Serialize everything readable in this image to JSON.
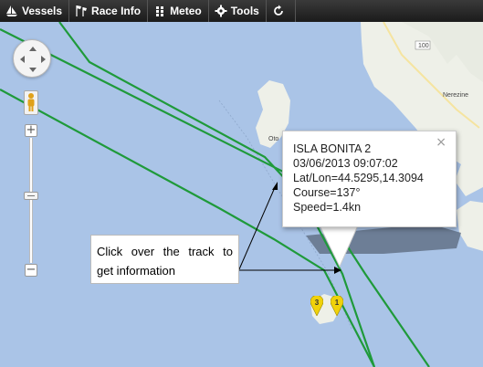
{
  "toolbar": {
    "items": [
      {
        "label": "Vessels",
        "icon": "sailboat-icon"
      },
      {
        "label": "Race Info",
        "icon": "flags-icon"
      },
      {
        "label": "Meteo",
        "icon": "grid-icon"
      },
      {
        "label": "Tools",
        "icon": "gear-icon"
      },
      {
        "label": "",
        "icon": "refresh-icon"
      }
    ]
  },
  "map": {
    "labels": {
      "island": "Oto",
      "town": "Nerezine",
      "road": "100"
    },
    "markers": [
      {
        "label": "3"
      },
      {
        "label": "1"
      }
    ],
    "track_color": "#1f9a3a",
    "marker_color": "#f0d20a"
  },
  "zoom": {
    "plus": "+",
    "minus": "−"
  },
  "popup": {
    "lines": [
      "ISLA BONITA 2",
      "03/06/2013 09:07:02",
      "Lat/Lon=44.5295,14.3094",
      "Course=137°",
      "Speed=1.4kn"
    ],
    "close": "×"
  },
  "callout": {
    "line1": "Click over the track to",
    "line2": "get information"
  }
}
